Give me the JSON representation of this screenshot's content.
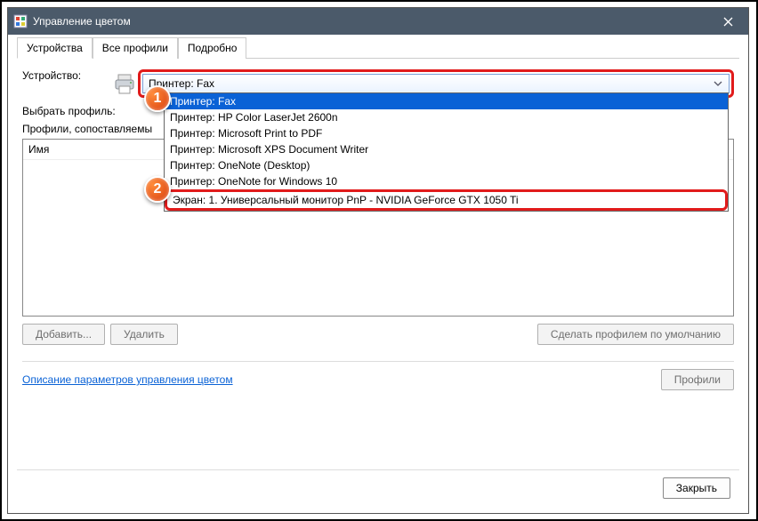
{
  "window": {
    "title": "Управление цветом"
  },
  "tabs": {
    "t0": "Устройства",
    "t1": "Все профили",
    "t2": "Подробно"
  },
  "labels": {
    "device": "Устройство:",
    "select_profile": "Выбрать профиль:",
    "profiles_for": "Профили, сопоставляемы",
    "col_name": "Имя"
  },
  "combo": {
    "selected": "Принтер: Fax"
  },
  "dropdown": {
    "i0": "Принтер: Fax",
    "i1": "Принтер: HP Color LaserJet 2600n",
    "i2": "Принтер: Microsoft Print to PDF",
    "i3": "Принтер: Microsoft XPS Document Writer",
    "i4": "Принтер: OneNote (Desktop)",
    "i5": "Принтер: OneNote for Windows 10",
    "i6": "Экран: 1. Универсальный монитор PnP - NVIDIA GeForce GTX 1050 Ti"
  },
  "buttons": {
    "add": "Добавить...",
    "remove": "Удалить",
    "set_default": "Сделать профилем по умолчанию",
    "profiles": "Профили",
    "close": "Закрыть"
  },
  "link": "Описание параметров управления цветом",
  "callouts": {
    "c1": "1",
    "c2": "2"
  }
}
